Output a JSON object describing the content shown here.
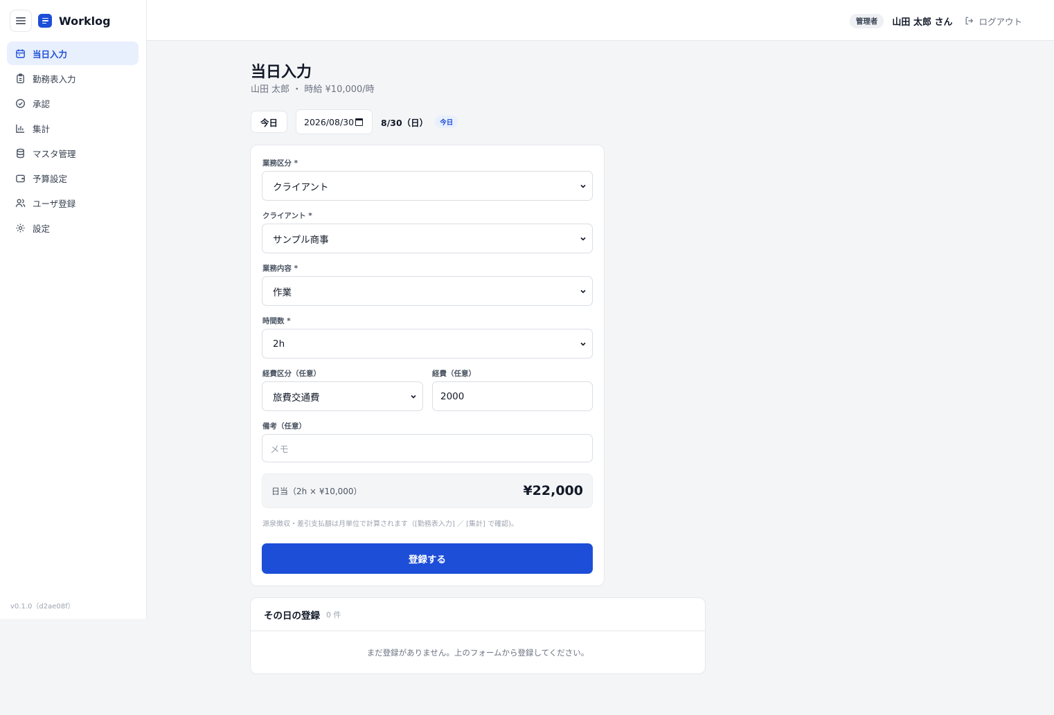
{
  "app": {
    "name": "Worklog",
    "version": "v0.1.0（d2ae08f）"
  },
  "sidebar": {
    "items": [
      {
        "label": "当日入力",
        "icon": "calendar-icon",
        "active": true
      },
      {
        "label": "勤務表入力",
        "icon": "clipboard-icon",
        "active": false
      },
      {
        "label": "承認",
        "icon": "check-circle-icon",
        "active": false
      },
      {
        "label": "集計",
        "icon": "bar-chart-icon",
        "active": false
      },
      {
        "label": "マスタ管理",
        "icon": "database-icon",
        "active": false
      },
      {
        "label": "予算設定",
        "icon": "wallet-icon",
        "active": false
      },
      {
        "label": "ユーザ登録",
        "icon": "users-icon",
        "active": false
      },
      {
        "label": "設定",
        "icon": "gear-icon",
        "active": false
      }
    ]
  },
  "header": {
    "role": "管理者",
    "user": "山田 太郎 さん",
    "logout": "ログアウト"
  },
  "page": {
    "title": "当日入力",
    "subtitle": "山田 太郎 ・ 時給 ¥10,000/時"
  },
  "date_bar": {
    "today_button": "今日",
    "date_value": "2026/08/30",
    "date_label": "8/30（日）",
    "today_badge": "今日"
  },
  "form": {
    "business_type": {
      "label": "業務区分 *",
      "value": "クライアント"
    },
    "client": {
      "label": "クライアント *",
      "value": "サンプル商事"
    },
    "work_content": {
      "label": "業務内容 *",
      "value": "作業"
    },
    "hours": {
      "label": "時間数 *",
      "value": "2h"
    },
    "expense_type": {
      "label": "経費区分（任意）",
      "value": "旅費交通費"
    },
    "expense": {
      "label": "経費（任意）",
      "value": "2000"
    },
    "memo": {
      "label": "備考（任意）",
      "placeholder": "メモ",
      "value": ""
    },
    "daily_total": {
      "label": "日当（2h × ¥10,000）",
      "value": "¥22,000"
    },
    "note": "源泉徴収・差引支払額は月単位で計算されます（[勤務表入力] ／ [集計] で確認)。",
    "submit": "登録する"
  },
  "entries": {
    "title": "その日の登録",
    "count": "0 件",
    "empty": "まだ登録がありません。上のフォームから登録してください。"
  },
  "colors": {
    "accent": "#1d4ed8",
    "active_bg": "#e8effd",
    "page_bg": "#f4f5f7"
  }
}
